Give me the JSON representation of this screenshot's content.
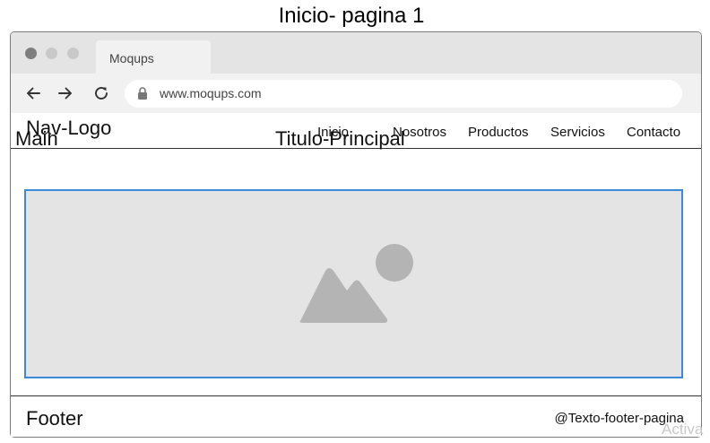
{
  "page_title": "Inicio- pagina 1",
  "browser": {
    "tab_label": "Moqups",
    "url": "www.moqups.com"
  },
  "nav": {
    "logo": "Nav-Logo",
    "links": [
      "Inicio",
      "Nosotros",
      "Productos",
      "Servicios",
      "Contacto"
    ]
  },
  "main": {
    "label": "Main",
    "title": "Titulo-Principal",
    "image_icon": "image-placeholder-icon"
  },
  "footer": {
    "label": "Footer",
    "text": "@Texto-footer-pagina"
  },
  "watermark": "Activa",
  "colors": {
    "image_border": "#3a8ad8",
    "image_fill": "#e4e4e4",
    "icon_fill": "#b4b4b4"
  }
}
